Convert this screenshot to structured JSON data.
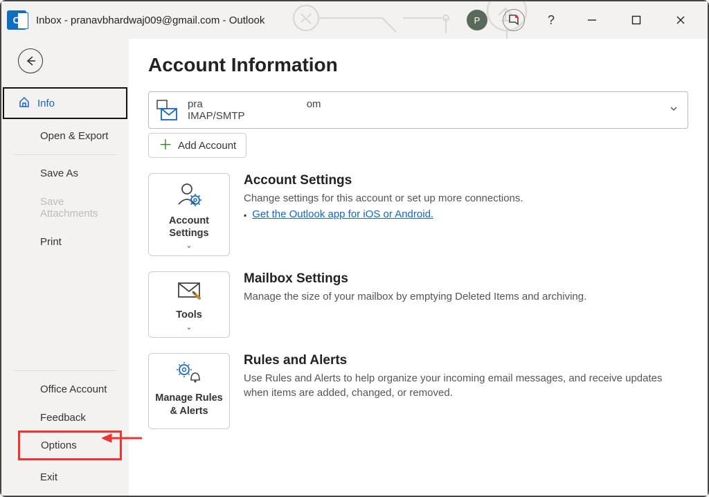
{
  "titlebar": {
    "title": "Inbox - pranavbhardwaj009@gmail.com  -  Outlook",
    "avatar_letter": "P"
  },
  "sidebar": {
    "items": {
      "info": "Info",
      "open_export": "Open & Export",
      "save_as": "Save As",
      "save_attachments": "Save Attachments",
      "print": "Print",
      "office_account": "Office Account",
      "feedback": "Feedback",
      "options": "Options",
      "exit": "Exit"
    }
  },
  "page": {
    "title": "Account Information",
    "account": {
      "email_prefix": "pra",
      "email_suffix": "om",
      "type": "IMAP/SMTP"
    },
    "add_account": "Add Account",
    "sections": {
      "account_settings": {
        "tile": "Account Settings",
        "title": "Account Settings",
        "desc": "Change settings for this account or set up more connections.",
        "link": "Get the Outlook app for iOS or Android."
      },
      "mailbox": {
        "tile": "Tools",
        "title": "Mailbox Settings",
        "desc": "Manage the size of your mailbox by emptying Deleted Items and archiving."
      },
      "rules": {
        "tile": "Manage Rules & Alerts",
        "title": "Rules and Alerts",
        "desc": "Use Rules and Alerts to help organize your incoming email messages, and receive updates when items are added, changed, or removed."
      }
    }
  }
}
